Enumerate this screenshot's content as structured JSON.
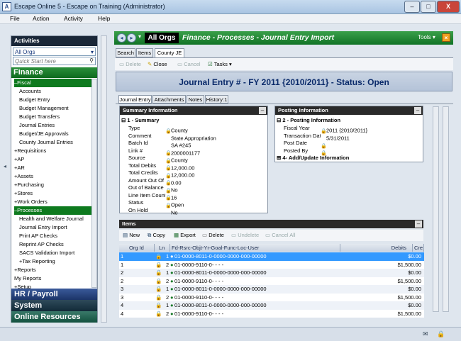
{
  "window": {
    "title": "Escape Online 5 - Escape on Training (Administrator)",
    "min": "–",
    "max": "□",
    "close": "X"
  },
  "menu": [
    "File",
    "Action",
    "Activity",
    "Help"
  ],
  "sidebar": {
    "header": "Activities",
    "org_select": "All Orgs",
    "search_placeholder": "Quick Start here",
    "finance_label": "Finance",
    "items": [
      "–Fiscal",
      "Accounts",
      "Budget Entry",
      "Budget Management",
      "Budget Transfers",
      "Journal Entries",
      "Budget/JE Approvals",
      "County Journal Entries",
      "+Requisitions",
      "+AP",
      "+AR",
      "+Assets",
      "+Purchasing",
      "+Stores",
      "+Work Orders",
      "–Processes",
      "Health and Welfare Journal",
      "Journal Entry Import",
      "Print AP Checks",
      "Reprint AP Checks",
      "SACS Validation Import",
      "+Tax Reporting",
      "+Reports",
      "My Reports",
      "+Setup"
    ],
    "bottom": [
      "HR / Payroll",
      "System",
      "Online Resources"
    ]
  },
  "topbar": {
    "org": "All Orgs",
    "breadcrumb": "Finance - Processes - Journal Entry Import",
    "tools": "Tools ▾"
  },
  "tabs": [
    "Search",
    "Items",
    "County JE"
  ],
  "toolbar": {
    "delete": "Delete",
    "close": "Close",
    "cancel": "Cancel",
    "tasks": "Tasks"
  },
  "header": "Journal Entry #  - FY 2011 {2010/2011} - Status: Open",
  "subtabs": [
    "Journal Entry",
    "Attachments",
    "Notes",
    "History:1"
  ],
  "summary": {
    "title": "Summary Information",
    "group": "1 - Summary",
    "rows": [
      {
        "k": "Type",
        "v": "County"
      },
      {
        "k": "Comment",
        "v": "State Appropriation"
      },
      {
        "k": "Batch Id",
        "v": "SA #245"
      },
      {
        "k": "Link #",
        "v": "2000001177"
      },
      {
        "k": "Source",
        "v": "County"
      },
      {
        "k": "Total Debits",
        "v": "12,000.00"
      },
      {
        "k": "Total Credits",
        "v": "12,000.00"
      },
      {
        "k": "Amount Out Of Bal",
        "v": "0.00"
      },
      {
        "k": "Out of Balance",
        "v": "No"
      },
      {
        "k": "Line Item Count",
        "v": "16"
      },
      {
        "k": "Status",
        "v": "Open"
      },
      {
        "k": "On Hold",
        "v": "No"
      }
    ]
  },
  "posting": {
    "title": "Posting Information",
    "group": "2 - Posting Information",
    "rows": [
      {
        "k": "Fiscal Year",
        "v": "2011 {2010/2011}"
      },
      {
        "k": "Transaction Date",
        "v": "5/31/2011"
      },
      {
        "k": "Post Date",
        "v": ""
      },
      {
        "k": "Posted By",
        "v": ""
      }
    ],
    "group2": "4- Add/Update Information"
  },
  "items": {
    "title": "Items",
    "toolbar": {
      "new": "New",
      "copy": "Copy",
      "export": "Export",
      "delete": "Delete",
      "undelete": "Undelete",
      "cancel_all": "Cancel All"
    },
    "columns": [
      "Org Id",
      "Ln",
      "Fd-Rsrc-Objt-Yr-Goal-Func-Loc-User",
      "Debits",
      "Cre"
    ],
    "rows": [
      {
        "org": "1",
        "ln": "1",
        "acct": "01-0000-8011-0-0000-0000-000-00000",
        "debit": "$0.00"
      },
      {
        "org": "1",
        "ln": "2",
        "acct": "01-0000-9110-0-  -  -  -",
        "debit": "$1,500.00"
      },
      {
        "org": "2",
        "ln": "1",
        "acct": "01-0000-8011-0-0000-0000-000-00000",
        "debit": "$0.00"
      },
      {
        "org": "2",
        "ln": "2",
        "acct": "01-0000-9110-0-  -  -  -",
        "debit": "$1,500.00"
      },
      {
        "org": "3",
        "ln": "1",
        "acct": "01-0000-8011-0-0000-0000-000-00000",
        "debit": "$0.00"
      },
      {
        "org": "3",
        "ln": "2",
        "acct": "01-0000-9110-0-  -  -  -",
        "debit": "$1,500.00"
      },
      {
        "org": "4",
        "ln": "1",
        "acct": "01-0000-8011-0-0000-0000-000-00000",
        "debit": "$0.00"
      },
      {
        "org": "4",
        "ln": "2",
        "acct": "01-0000-9110-0-  -  -  -",
        "debit": "$1,500.00"
      }
    ]
  },
  "colors": {
    "green": "#117326",
    "dark": "#1a2738",
    "header_text": "#0a2a6a",
    "selected_row": "#3399ff"
  }
}
